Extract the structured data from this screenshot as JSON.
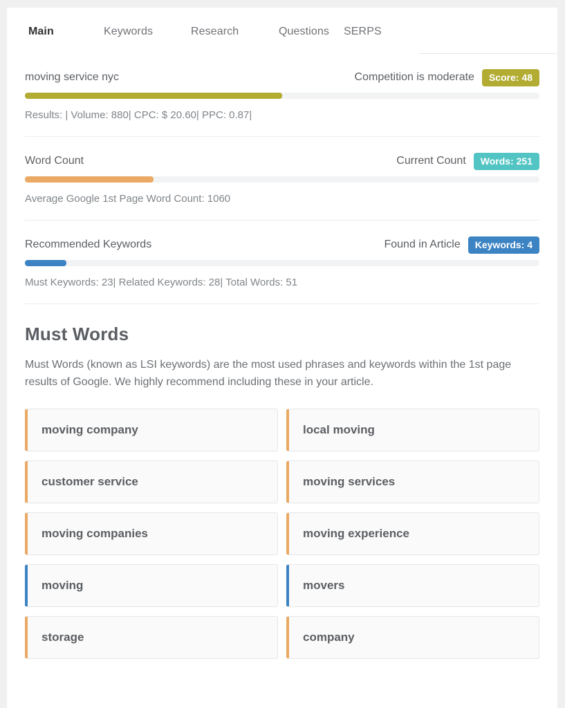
{
  "tabs": [
    {
      "label": "Main",
      "active": true
    },
    {
      "label": "Keywords",
      "active": false
    },
    {
      "label": "Research",
      "active": false
    },
    {
      "label": "Questions",
      "active": false
    },
    {
      "label": "SERPS",
      "active": false
    }
  ],
  "metrics": [
    {
      "title": "moving service nyc",
      "status": "Competition is moderate",
      "badge": "Score: 48",
      "badge_color": "#b2ac33",
      "bar_color": "#b2ac33",
      "bar_percent": 50,
      "sub": "Results: | Volume: 880| CPC: $ 20.60| PPC: 0.87|"
    },
    {
      "title": "Word Count",
      "status": "Current Count",
      "badge": "Words: 251",
      "badge_color": "#51c4c3",
      "bar_color": "#eaa964",
      "bar_percent": 25,
      "sub": "Average Google 1st Page Word Count: 1060"
    },
    {
      "title": "Recommended Keywords",
      "status": "Found in Article",
      "badge": "Keywords: 4",
      "badge_color": "#3c83c4",
      "bar_color": "#3c83c4",
      "bar_percent": 8,
      "sub": "Must Keywords: 23| Related Keywords: 28| Total Words: 51"
    }
  ],
  "must_words": {
    "heading": "Must Words",
    "description": "Must Words (known as LSI keywords) are the most used phrases and keywords within the 1st page results of Google. We highly recommend including these in your article.",
    "accent_orange": "#eaa964",
    "accent_blue": "#3c83c4",
    "keywords": [
      {
        "label": "moving company",
        "accent": "#eaa964"
      },
      {
        "label": "local moving",
        "accent": "#eaa964"
      },
      {
        "label": "customer service",
        "accent": "#eaa964"
      },
      {
        "label": "moving services",
        "accent": "#eaa964"
      },
      {
        "label": "moving companies",
        "accent": "#eaa964"
      },
      {
        "label": "moving experience",
        "accent": "#eaa964"
      },
      {
        "label": "moving",
        "accent": "#3c83c4"
      },
      {
        "label": "movers",
        "accent": "#3c83c4"
      },
      {
        "label": "storage",
        "accent": "#eaa964"
      },
      {
        "label": "company",
        "accent": "#eaa964"
      }
    ]
  }
}
